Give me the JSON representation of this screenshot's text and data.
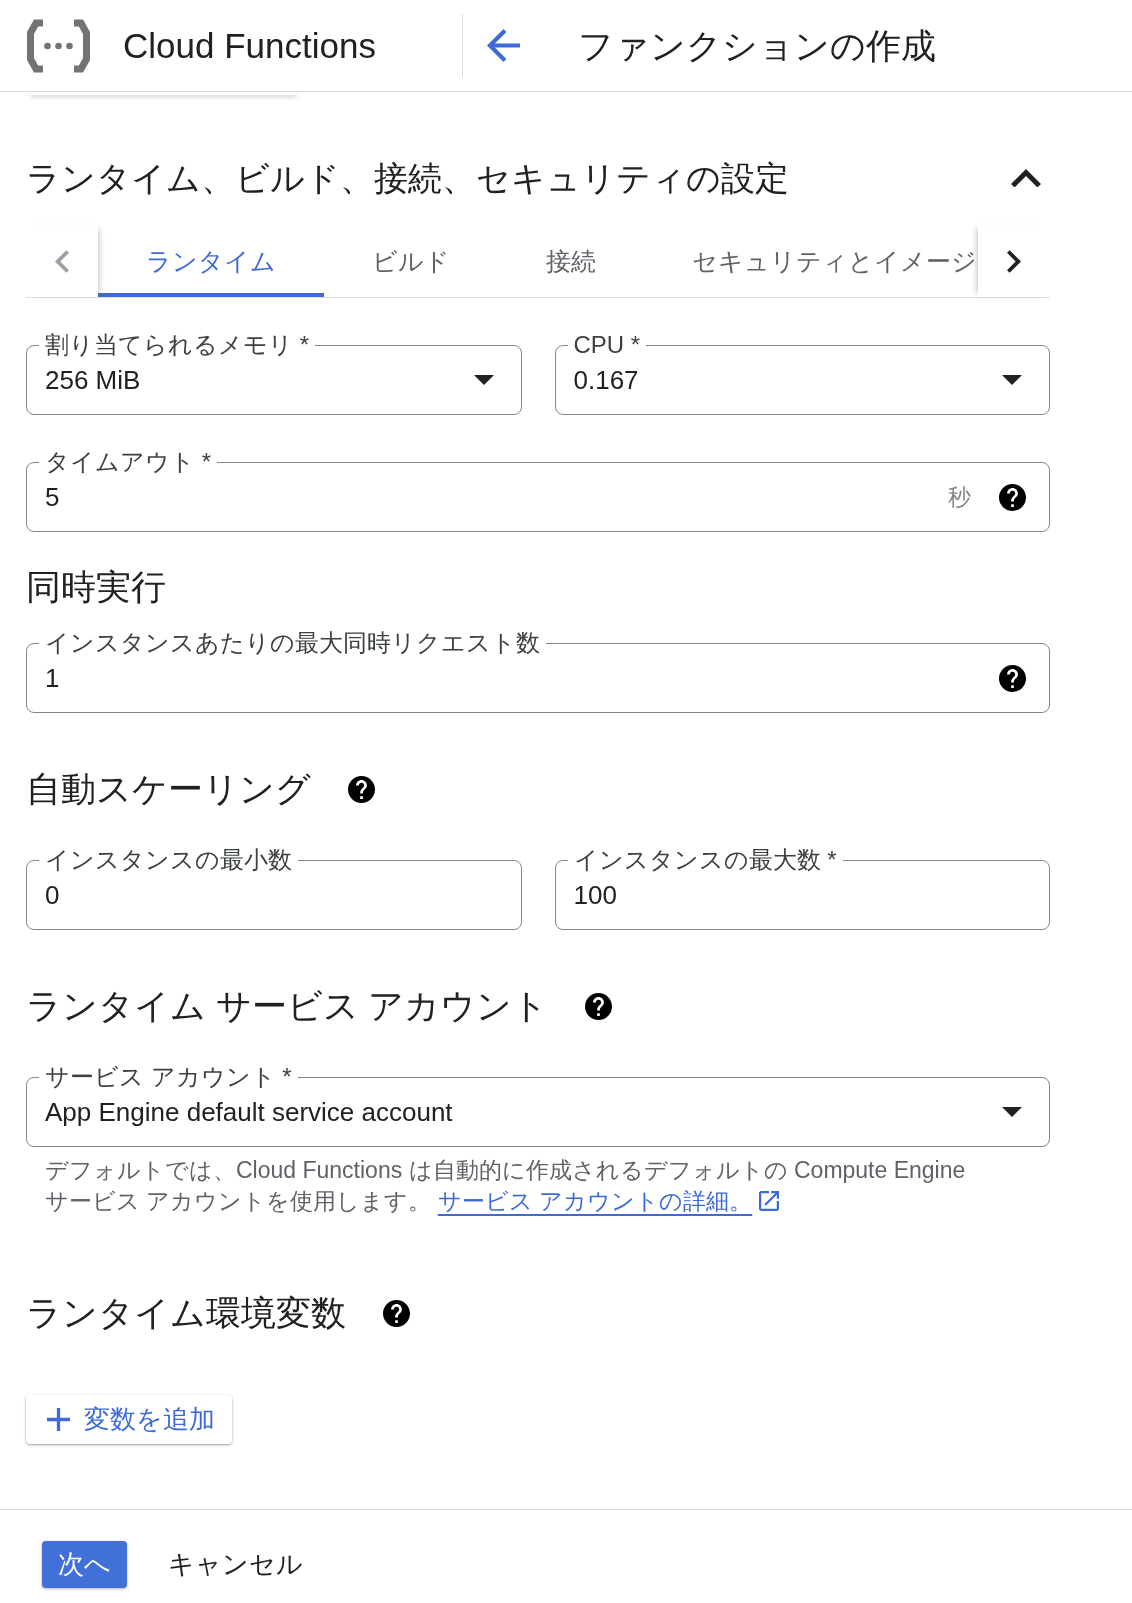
{
  "header": {
    "product": "Cloud Functions",
    "title": "ファンクションの作成"
  },
  "section": {
    "title": "ランタイム、ビルド、接続、セキュリティの設定",
    "expanded": true
  },
  "tab_scroll": {
    "back_disabled": true,
    "forward_disabled": false
  },
  "tabs": [
    {
      "label": "ランタイム",
      "selected": true
    },
    {
      "label": "ビルド",
      "selected": false
    },
    {
      "label": "接続",
      "selected": false
    },
    {
      "label": "セキュリティとイメージ",
      "selected": false
    }
  ],
  "blocks": [
    {
      "kind": "fields",
      "fields": [
        {
          "kind": "dropdown",
          "label": "割り当てられるメモリ *",
          "value": "256 MiB",
          "help": false
        },
        {
          "kind": "dropdown",
          "label": "CPU *",
          "value": "0.167",
          "help": false
        }
      ]
    },
    {
      "kind": "fields",
      "fields": [
        {
          "kind": "text",
          "label": "タイムアウト *",
          "value": "5",
          "suffix": "秒",
          "help": true
        }
      ]
    },
    {
      "kind": "heading",
      "text": "同時実行",
      "help": false
    },
    {
      "kind": "fields",
      "fields": [
        {
          "kind": "text",
          "label": "インスタンスあたりの最大同時リクエスト数",
          "value": "1",
          "help": true
        }
      ]
    },
    {
      "kind": "heading",
      "text": "自動スケーリング",
      "help": true
    },
    {
      "kind": "fields",
      "fields": [
        {
          "kind": "text",
          "label": "インスタンスの最小数",
          "value": "0",
          "help": false
        },
        {
          "kind": "text",
          "label": "インスタンスの最大数 *",
          "value": "100",
          "help": false
        }
      ]
    },
    {
      "kind": "heading",
      "text": "ランタイム サービス アカウント",
      "help": true
    },
    {
      "kind": "fields",
      "fields": [
        {
          "kind": "dropdown",
          "label": "サービス アカウント *",
          "value": "App Engine default service account",
          "help": false
        }
      ],
      "helper": {
        "text": "デフォルトでは、Cloud Functions は自動的に作成されるデフォルトの Compute Engine サービス アカウントを使用します。",
        "link": "サービス アカウントの詳細。"
      }
    },
    {
      "kind": "heading",
      "text": "ランタイム環境変数",
      "help": true
    },
    {
      "kind": "button",
      "label": "変数を追加"
    }
  ],
  "footer": {
    "buttons": [
      {
        "kind": "primary",
        "label": "次へ"
      },
      {
        "kind": "text",
        "label": "キャンセル"
      }
    ]
  }
}
